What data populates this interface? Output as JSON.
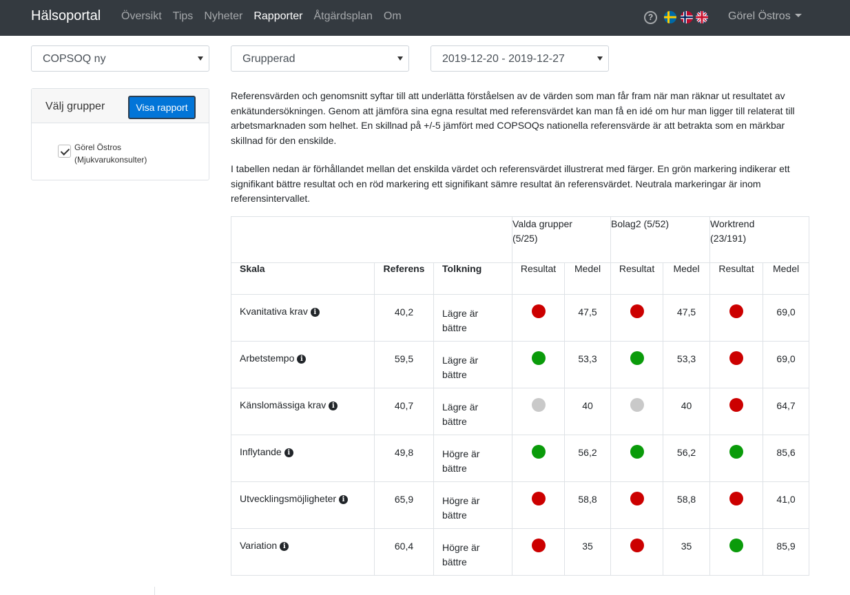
{
  "app": {
    "brand": "Hälsoportal"
  },
  "nav": {
    "items": [
      {
        "label": "Översikt",
        "active": false
      },
      {
        "label": "Tips",
        "active": false
      },
      {
        "label": "Nyheter",
        "active": false
      },
      {
        "label": "Rapporter",
        "active": true
      },
      {
        "label": "Åtgärdsplan",
        "active": false
      },
      {
        "label": "Om",
        "active": false
      }
    ],
    "user": "Görel Östros",
    "languages": [
      "Svenska",
      "Norsk",
      "English"
    ]
  },
  "filters": {
    "survey": "COPSOQ ny",
    "report_type": "Grupperad",
    "period": "2019-12-20 - 2019-12-27"
  },
  "groups": {
    "title": "Välj grupper",
    "show_button": "Visa rapport",
    "items": [
      {
        "line1": "Görel Östros",
        "line2": "(Mjukvarukonsulter)",
        "checked": true
      }
    ]
  },
  "text": {
    "para1": "Referensvärden och genomsnitt syftar till att underlätta förståelsen av de värden som man får fram när man räknar ut resultatet av enkätundersökningen. Genom att jämföra sina egna resultat med referensvärdet kan man få en idé om hur man ligger till relaterat till arbetsmarknaden som helhet. En skillnad på +/-5 jämfört med COPSOQs nationella referensvärde är att betrakta som en märkbar skillnad för den enskilde.",
    "para2": "I tabellen nedan är förhållandet mellan det enskilda värdet och referensvärdet illustrerat med färger. En grön markering indikerar ett signifikant bättre resultat och en röd markering ett signifikant sämre resultat än referensvärdet. Neutrala markeringar är inom referensintervallet."
  },
  "table": {
    "groups": [
      {
        "name": "Valda grupper",
        "count": "(5/25)"
      },
      {
        "name": "Bolag2",
        "count": "(5/52)"
      },
      {
        "name": "Worktrend",
        "count": "(23/191)"
      }
    ],
    "headers": {
      "skala": "Skala",
      "referens": "Referens",
      "tolkning": "Tolkning",
      "resultat": "Resultat",
      "medel": "Medel"
    },
    "rows": [
      {
        "skala": "Kvanitativa krav",
        "referens": "40,2",
        "tolkning": [
          "Lägre är",
          "bättre"
        ],
        "r1": "red",
        "m1": "47,5",
        "r2": "red",
        "m2": "47,5",
        "r3": "red",
        "m3": "69,0"
      },
      {
        "skala": "Arbetstempo",
        "referens": "59,5",
        "tolkning": [
          "Lägre är",
          "bättre"
        ],
        "r1": "green",
        "m1": "53,3",
        "r2": "green",
        "m2": "53,3",
        "r3": "red",
        "m3": "69,0"
      },
      {
        "skala": "Känslomässiga krav",
        "referens": "40,7",
        "tolkning": [
          "Lägre är",
          "bättre"
        ],
        "r1": "gray",
        "m1": "40",
        "r2": "gray",
        "m2": "40",
        "r3": "red",
        "m3": "64,7"
      },
      {
        "skala": "Inflytande",
        "referens": "49,8",
        "tolkning": [
          "Högre är",
          "bättre"
        ],
        "r1": "green",
        "m1": "56,2",
        "r2": "green",
        "m2": "56,2",
        "r3": "green",
        "m3": "85,6"
      },
      {
        "skala": "Utvecklingsmöjligheter",
        "referens": "65,9",
        "tolkning": [
          "Högre är",
          "bättre"
        ],
        "r1": "red",
        "m1": "58,8",
        "r2": "red",
        "m2": "58,8",
        "r3": "red",
        "m3": "41,0"
      },
      {
        "skala": "Variation",
        "referens": "60,4",
        "tolkning": [
          "Högre är",
          "bättre"
        ],
        "r1": "red",
        "m1": "35",
        "r2": "red",
        "m2": "35",
        "r3": "green",
        "m3": "85,9"
      }
    ]
  },
  "colors": {
    "navbar": "#343a40",
    "primary": "#0275d8",
    "good": "#0a9b0a",
    "bad": "#cc0000",
    "neutral": "#c9c9c9"
  }
}
